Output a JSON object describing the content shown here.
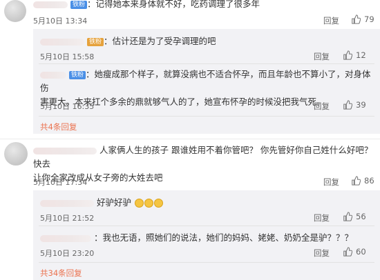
{
  "comments": [
    {
      "text": "：记得她本来身体就不好，吃药调理了很多年",
      "badge": "铁粉",
      "time": "5月10日 13:34",
      "reply": "回复",
      "likes": "79",
      "sub_replies": [
        {
          "badge": "铁粉",
          "text": "：估计还是为了受孕调理的吧",
          "time": "5月10日 15:58",
          "reply": "回复",
          "likes": "12"
        },
        {
          "badge": "铁粉",
          "text_line1": "：她瘦成那个样子，就算没病也不适合怀孕，而且年龄也不算小了，对身体伤",
          "text_line2": "害更大。本来扛个多余的鼎就够气人的了，她宣布怀孕的时候没把我气死。",
          "time": "5月10日 16:35",
          "reply": "回复",
          "likes": "39"
        }
      ],
      "more_label": "共4条回复"
    },
    {
      "text_line1": "人家俩人生的孩子 跟谁姓用不着你管吧？ 你先管好你自己姓什么好吧？ 快去",
      "text_line2": "让你全家改成从女子旁的大姓去吧",
      "time": "5月10日 17:34",
      "reply": "回复",
      "likes": "86",
      "sub_replies": [
        {
          "text": "好驴好驴",
          "time": "5月10日 21:52",
          "reply": "回复",
          "likes": "56"
        },
        {
          "text": "：我也无语，照她们的说法，她们的妈妈、姥姥、奶奶全是驴？？？",
          "time": "5月10日 23:20",
          "reply": "回复",
          "likes": "60"
        }
      ],
      "more_label": "共34条回复"
    }
  ],
  "icons": {
    "like": "thumbs-up-icon",
    "avatar": "avatar"
  }
}
